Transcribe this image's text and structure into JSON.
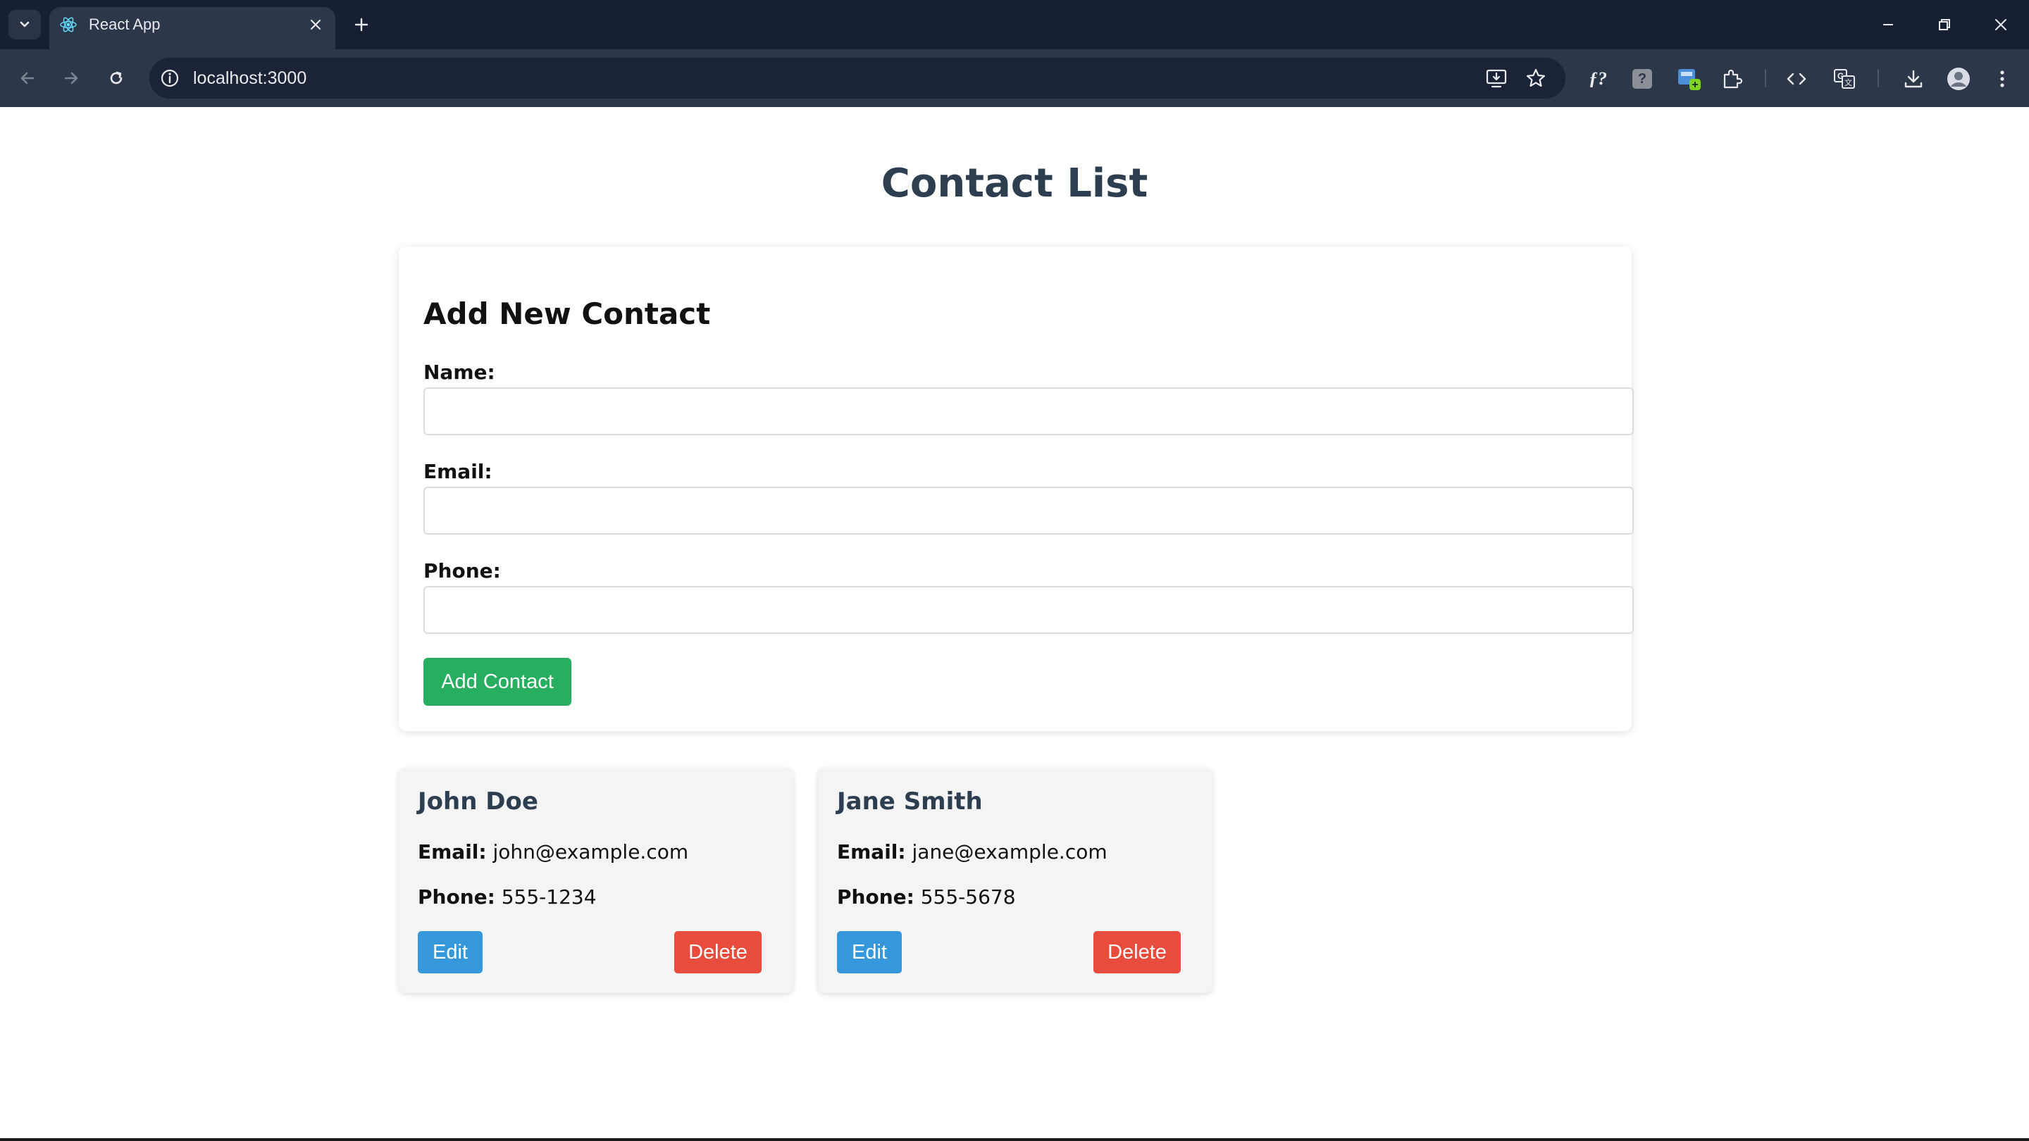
{
  "browser": {
    "tab": {
      "title": "React App",
      "favicon": "react-logo-icon"
    },
    "address_bar": {
      "url": "localhost:3000"
    },
    "colors": {
      "frame": "#172033",
      "toolbar": "#2d374a"
    }
  },
  "page": {
    "title": "Contact List"
  },
  "form": {
    "heading": "Add New Contact",
    "fields": [
      {
        "label": "Name:",
        "value": ""
      },
      {
        "label": "Email:",
        "value": ""
      },
      {
        "label": "Phone:",
        "value": ""
      }
    ],
    "submit_label": "Add Contact",
    "submit_color": "#27ae60"
  },
  "contacts": [
    {
      "name": "John Doe",
      "email_label": "Email:",
      "email": "john@example.com",
      "phone_label": "Phone:",
      "phone": "555-1234",
      "edit_label": "Edit",
      "delete_label": "Delete"
    },
    {
      "name": "Jane Smith",
      "email_label": "Email:",
      "email": "jane@example.com",
      "phone_label": "Phone:",
      "phone": "555-5678",
      "edit_label": "Edit",
      "delete_label": "Delete"
    }
  ],
  "colors": {
    "edit_button": "#3498db",
    "delete_button": "#e74c3c",
    "title_text": "#2c3e50"
  }
}
